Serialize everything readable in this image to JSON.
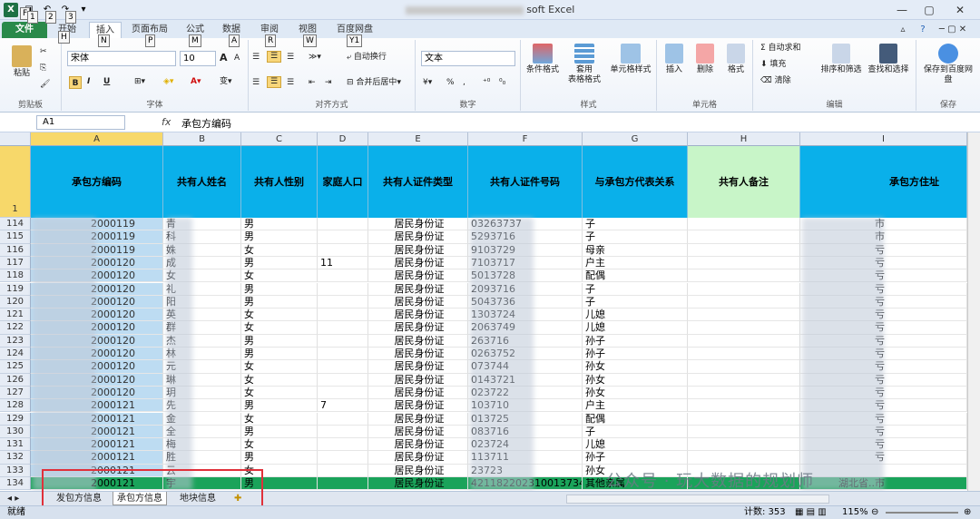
{
  "app": {
    "logo": "X",
    "title_suffix": "soft Excel"
  },
  "keytips": [
    "F",
    "1",
    "2",
    "3",
    "H",
    "N",
    "P",
    "M",
    "A",
    "R",
    "W",
    "Y1"
  ],
  "tabs": [
    "文件",
    "开始",
    "插入",
    "页面布局",
    "公式",
    "数据",
    "审阅",
    "视图",
    "百度网盘"
  ],
  "ribbon": {
    "clipboard": {
      "paste": "粘贴",
      "label": "剪贴板"
    },
    "font": {
      "name": "宋体",
      "size": "10",
      "bold": "B",
      "italic": "I",
      "underline": "U",
      "label": "字体",
      "grow": "A",
      "shrink": "A"
    },
    "align": {
      "wrap": "自动换行",
      "merge": "合并后居中",
      "label": "对齐方式"
    },
    "number": {
      "format": "文本",
      "percent": "%",
      "comma": ",",
      "label": "数字"
    },
    "styles": {
      "cond": "条件格式",
      "table": "套用\n表格格式",
      "cell": "单元格样式",
      "label": "样式"
    },
    "cells": {
      "insert": "插入",
      "delete": "删除",
      "format": "格式",
      "label": "单元格"
    },
    "edit": {
      "sum": "Σ 自动求和",
      "fill": "填充",
      "clear": "清除",
      "sort": "排序和筛选",
      "find": "查找和选择",
      "label": "编辑"
    },
    "save": {
      "btn": "保存到百度网盘",
      "label": "保存"
    }
  },
  "formula": {
    "name_box": "A1",
    "fx": "fx",
    "value": "承包方编码"
  },
  "columns": [
    "A",
    "B",
    "C",
    "D",
    "E",
    "F",
    "G",
    "H",
    "I"
  ],
  "headers": [
    "承包方编码",
    "共有人姓名",
    "共有人性别",
    "家庭人口",
    "共有人证件类型",
    "共有人证件号码",
    "与承包方代表关系",
    "共有人备注",
    "承包方住址"
  ],
  "rows": [
    {
      "n": "114",
      "a": "2000119",
      "b": "青",
      "c": "男",
      "d": "",
      "e": "居民身份证",
      "f": "03263737",
      "g": "子",
      "i": "市"
    },
    {
      "n": "115",
      "a": "2000119",
      "b": "科",
      "c": "男",
      "d": "",
      "e": "居民身份证",
      "f": "5293716",
      "g": "子",
      "i": "市"
    },
    {
      "n": "116",
      "a": "2000119",
      "b": "姝",
      "c": "女",
      "d": "",
      "e": "居民身份证",
      "f": "9103729",
      "g": "母亲",
      "i": "亏"
    },
    {
      "n": "117",
      "a": "2000120",
      "b": "成",
      "c": "男",
      "d": "11",
      "e": "居民身份证",
      "f": "7103717",
      "g": "户主",
      "i": "亏"
    },
    {
      "n": "118",
      "a": "2000120",
      "b": "女",
      "c": "女",
      "d": "",
      "e": "居民身份证",
      "f": "5013728",
      "g": "配偶",
      "i": "亏"
    },
    {
      "n": "119",
      "a": "2000120",
      "b": "礼",
      "c": "男",
      "d": "",
      "e": "居民身份证",
      "f": "2093716",
      "g": "子",
      "i": "亏"
    },
    {
      "n": "120",
      "a": "2000120",
      "b": "阳",
      "c": "男",
      "d": "",
      "e": "居民身份证",
      "f": "5043736",
      "g": "子",
      "i": "亏"
    },
    {
      "n": "121",
      "a": "2000120",
      "b": "英",
      "c": "女",
      "d": "",
      "e": "居民身份证",
      "f": "1303724",
      "g": "儿媳",
      "i": "亏"
    },
    {
      "n": "122",
      "a": "2000120",
      "b": "群",
      "c": "女",
      "d": "",
      "e": "居民身份证",
      "f": "2063749",
      "g": "儿媳",
      "i": "亏"
    },
    {
      "n": "123",
      "a": "2000120",
      "b": "杰",
      "c": "男",
      "d": "",
      "e": "居民身份证",
      "f": "263716",
      "g": "孙子",
      "i": "亏"
    },
    {
      "n": "124",
      "a": "2000120",
      "b": "林",
      "c": "男",
      "d": "",
      "e": "居民身份证",
      "f": "0263752",
      "g": "孙子",
      "i": "亏"
    },
    {
      "n": "125",
      "a": "2000120",
      "b": "元",
      "c": "女",
      "d": "",
      "e": "居民身份证",
      "f": "073744",
      "g": "孙女",
      "i": "亏"
    },
    {
      "n": "126",
      "a": "2000120",
      "b": "琳",
      "c": "女",
      "d": "",
      "e": "居民身份证",
      "f": "0143721",
      "g": "孙女",
      "i": "亏"
    },
    {
      "n": "127",
      "a": "2000120",
      "b": "玥",
      "c": "女",
      "d": "",
      "e": "居民身份证",
      "f": "023722",
      "g": "孙女",
      "i": "亏"
    },
    {
      "n": "128",
      "a": "2000121",
      "b": "先",
      "c": "男",
      "d": "7",
      "e": "居民身份证",
      "f": "103710",
      "g": "户主",
      "i": "亏"
    },
    {
      "n": "129",
      "a": "2000121",
      "b": "金",
      "c": "女",
      "d": "",
      "e": "居民身份证",
      "f": "013725",
      "g": "配偶",
      "i": "亏"
    },
    {
      "n": "130",
      "a": "2000121",
      "b": "全",
      "c": "男",
      "d": "",
      "e": "居民身份证",
      "f": "083716",
      "g": "子",
      "i": "亏"
    },
    {
      "n": "131",
      "a": "2000121",
      "b": "梅",
      "c": "女",
      "d": "",
      "e": "居民身份证",
      "f": "023724",
      "g": "儿媳",
      "i": "亏"
    },
    {
      "n": "132",
      "a": "2000121",
      "b": "胜",
      "c": "男",
      "d": "",
      "e": "居民身份证",
      "f": "113711",
      "g": "孙子",
      "i": "亏"
    },
    {
      "n": "133",
      "a": "2000121",
      "b": "云",
      "c": "女",
      "d": "",
      "e": "居民身份证",
      "f": "23723",
      "g": "孙女",
      "i": ""
    },
    {
      "n": "134",
      "a": "2000121",
      "b": "宇",
      "c": "男",
      "d": "",
      "e": "居民身份证",
      "f": "421182202310013734",
      "g": "其他亲属",
      "i": "湖北省..市"
    }
  ],
  "sheet_tabs": [
    "发包方信息",
    "承包方信息",
    "地块信息"
  ],
  "status": {
    "ready": "就绪",
    "count": "计数: 353",
    "zoom": "115%"
  },
  "watermark": "公众号 · 玩大数据的规划师"
}
